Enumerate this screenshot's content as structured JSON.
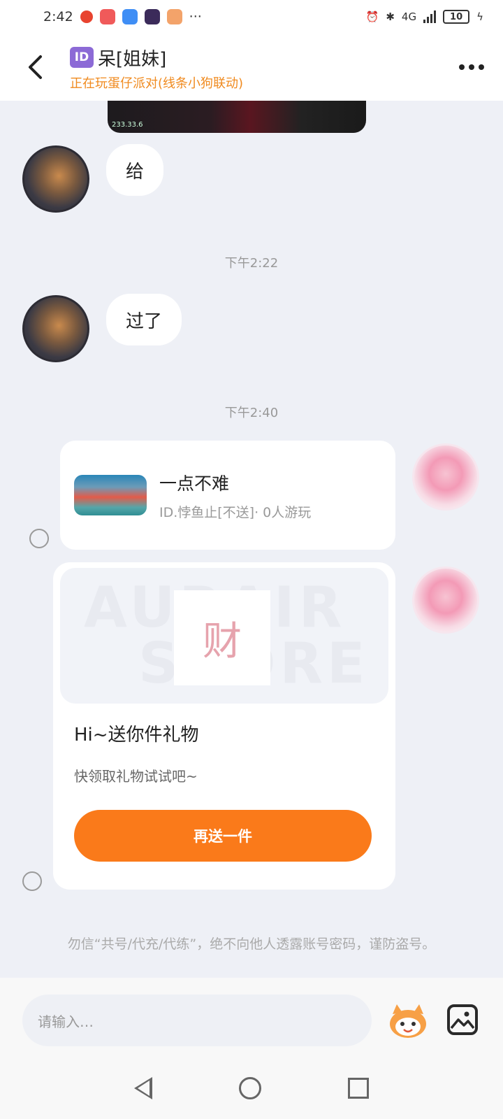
{
  "status_bar": {
    "time": "2:42",
    "network": "4G",
    "battery": "10"
  },
  "header": {
    "id_badge": "ID",
    "title": "呆[姐妹]",
    "subtitle": "正在玩蛋仔派对(线条小狗联动)"
  },
  "messages": [
    {
      "sender": "other",
      "text": "给"
    },
    {
      "type": "timestamp",
      "text": "下午2:22"
    },
    {
      "sender": "other",
      "text": "过了"
    },
    {
      "type": "timestamp",
      "text": "下午2:40"
    }
  ],
  "media_top": {
    "tag": "233.33.6"
  },
  "game_card": {
    "title": "一点不难",
    "subtitle": "ID.悖鱼止[不送]· 0人游玩"
  },
  "gift_card": {
    "bg_text_1": "AURAIR",
    "bg_text_2": "SCORE",
    "gift_char": "财",
    "title": "Hi~送你件礼物",
    "description": "快领取礼物试试吧~",
    "button_label": "再送一件"
  },
  "notice": "勿信“共号/代充/代练”，绝不向他人透露账号密码，谨防盗号。",
  "input": {
    "placeholder": "请输入…"
  },
  "icons": {
    "back": "back-arrow-icon",
    "more": "more-dots-icon",
    "sticker": "sticker-mascot-icon",
    "image": "image-picker-icon"
  },
  "colors": {
    "accent_orange": "#fa7a1a",
    "subtitle_orange": "#f08a1e",
    "id_badge_purple": "#8c6ad6"
  }
}
